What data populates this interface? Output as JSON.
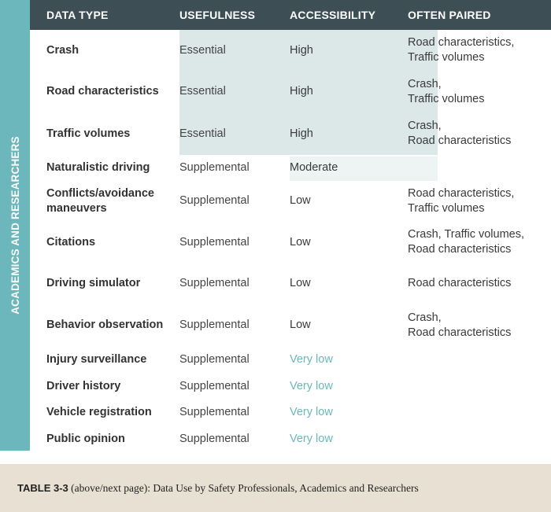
{
  "side_label": "ACADEMICS AND RESEARCHERS",
  "colors": {
    "teal": "#6cb7bb",
    "header_bg": "#3d4f54",
    "highlight_strong": "#dce8e7",
    "highlight_soft": "#edf4f3",
    "page_bg": "#e8e0d3",
    "very_low_text": "#6cb7bb"
  },
  "table": {
    "columns": [
      {
        "key": "data_type",
        "label": "DATA TYPE"
      },
      {
        "key": "usefulness",
        "label": "USEFULNESS"
      },
      {
        "key": "accessibility",
        "label": "ACCESSIBILITY"
      },
      {
        "key": "often_paired",
        "label": "OFTEN PAIRED"
      }
    ],
    "rows": [
      {
        "data_type": "Crash",
        "usefulness": "Essential",
        "accessibility": "High",
        "often_paired_line1": "Road characteristics,",
        "often_paired_line2": "Traffic volumes",
        "height": 52
      },
      {
        "data_type": "Road characteristics",
        "usefulness": "Essential",
        "accessibility": "High",
        "often_paired_line1": "Crash,",
        "often_paired_line2": "Traffic volumes",
        "height": 53
      },
      {
        "data_type": "Traffic volumes",
        "usefulness": "Essential",
        "accessibility": "High",
        "often_paired_line1": "Crash,",
        "often_paired_line2": "Road characteristics",
        "height": 54
      },
      {
        "data_type": "Naturalistic driving",
        "usefulness": "Supplemental",
        "accessibility": "Moderate",
        "often_paired_line1": "",
        "often_paired_line2": "",
        "height": 32
      },
      {
        "data_type_line1": "Conflicts/avoidance",
        "data_type_line2": "maneuvers",
        "data_type": "Conflicts/avoidance maneuvers",
        "usefulness": "Supplemental",
        "accessibility": "Low",
        "often_paired_line1": "Road characteristics,",
        "often_paired_line2": "Traffic volumes",
        "height": 53
      },
      {
        "data_type": "Citations",
        "usefulness": "Supplemental",
        "accessibility": "Low",
        "often_paired_line1": "Crash, Traffic volumes,",
        "often_paired_line2": "Road characteristics",
        "height": 52
      },
      {
        "data_type": "Driving simulator",
        "usefulness": "Supplemental",
        "accessibility": "Low",
        "often_paired_line1": "Road characteristics",
        "often_paired_line2": "",
        "height": 53
      },
      {
        "data_type": "Behavior observation",
        "usefulness": "Supplemental",
        "accessibility": "Low",
        "often_paired_line1": "Crash,",
        "often_paired_line2": "Road characteristics",
        "height": 53
      },
      {
        "data_type": "Injury surveillance",
        "usefulness": "Supplemental",
        "accessibility": "Very low",
        "often_paired_line1": "",
        "often_paired_line2": "",
        "height": 34
      },
      {
        "data_type": "Driver history",
        "usefulness": "Supplemental",
        "accessibility": "Very low",
        "often_paired_line1": "",
        "often_paired_line2": "",
        "height": 34
      },
      {
        "data_type": "Vehicle registration",
        "usefulness": "Supplemental",
        "accessibility": "Very low",
        "often_paired_line1": "",
        "often_paired_line2": "",
        "height": 33
      },
      {
        "data_type": "Public opinion",
        "usefulness": "Supplemental",
        "accessibility": "Very low",
        "often_paired_line1": "",
        "often_paired_line2": "",
        "height": 34
      }
    ]
  },
  "caption": {
    "label": "TABLE 3-3",
    "rest": " (above/next page): Data Use by Safety Professionals, Academics and Researchers"
  }
}
